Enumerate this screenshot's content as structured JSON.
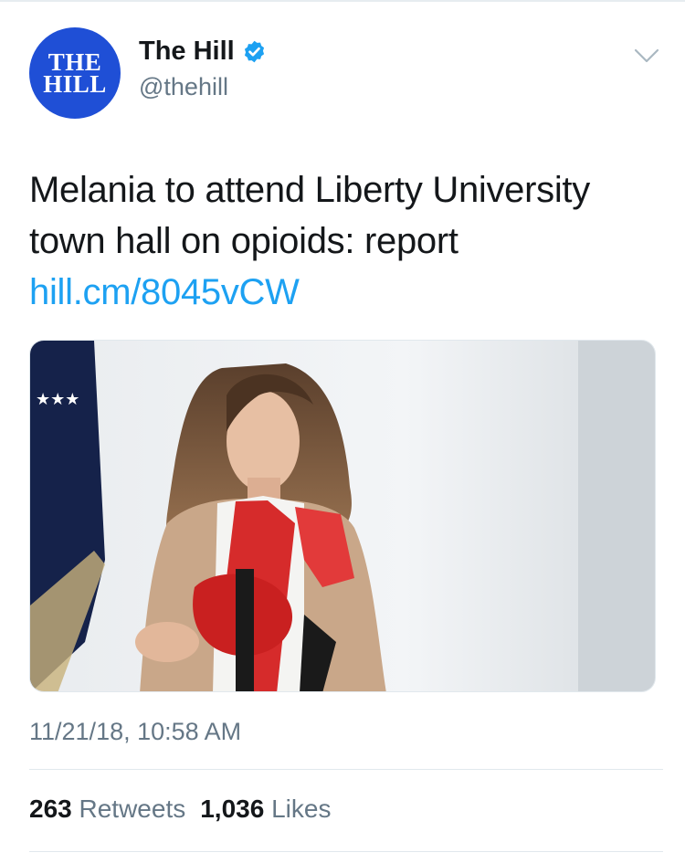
{
  "account": {
    "display_name": "The Hill",
    "handle": "@thehill",
    "avatar_text": [
      "THE",
      "HILL"
    ],
    "verified": true,
    "avatar_color": "#1f4fd6"
  },
  "tweet": {
    "text": "Melania to attend Liberty University town hall on opioids: report ",
    "link": "hill.cm/8045vCW",
    "timestamp": "11/21/18, 10:58 AM"
  },
  "stats": {
    "retweets_count": "263",
    "retweets_label": "Retweets",
    "likes_count": "1,036",
    "likes_label": "Likes"
  },
  "icons": {
    "verified": "verified-badge-icon",
    "menu": "chevron-down-icon"
  },
  "colors": {
    "link": "#1da1f2",
    "secondary_text": "#657786",
    "primary_text": "#14171a"
  }
}
